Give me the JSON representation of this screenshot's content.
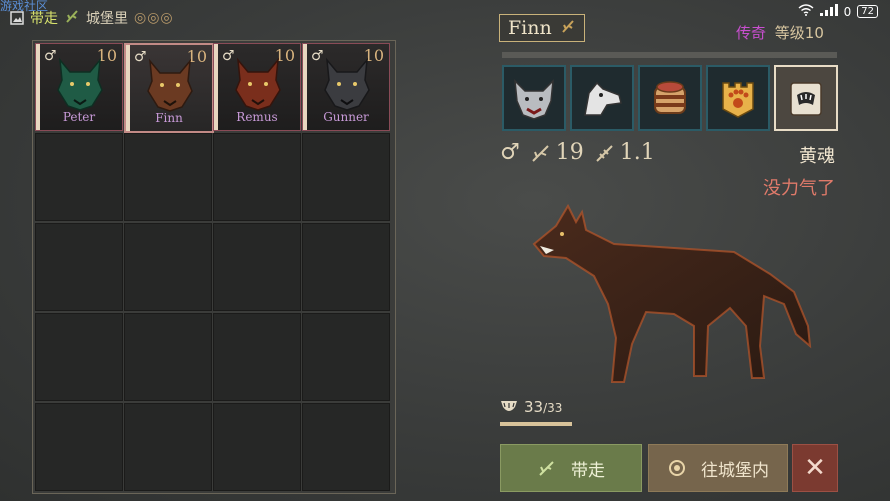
{
  "watermark": "游戏社区",
  "topbar": {
    "tab_take": "带走",
    "tab_castle": "城堡里",
    "rings": "◎◎◎"
  },
  "slots": [
    {
      "name": "Peter",
      "level": "10",
      "sex": "♂",
      "fur": "#1f5b45"
    },
    {
      "name": "Finn",
      "level": "10",
      "sex": "♂",
      "fur": "#6b3a22"
    },
    {
      "name": "Remus",
      "level": "10",
      "sex": "♂",
      "fur": "#7a2e1c"
    },
    {
      "name": "Gunner",
      "level": "10",
      "sex": "♂",
      "fur": "#3b3c40"
    }
  ],
  "detail": {
    "name": "Finn",
    "rarity": "传奇",
    "level_label": "等级10",
    "sex": "♂",
    "attack": "19",
    "speed": "1.1",
    "soul": "黄魂",
    "status": "没力气了",
    "hunger": "33",
    "hunger_max": "/33"
  },
  "buttons": {
    "take": "带走",
    "to_castle": "往城堡内",
    "close": "✕"
  },
  "system": {
    "signal": "0",
    "battery": "72"
  },
  "colors": {
    "accent_legend": "#c94fd0",
    "status_red": "#e07a6a",
    "take_green": "#6a7b4a"
  }
}
